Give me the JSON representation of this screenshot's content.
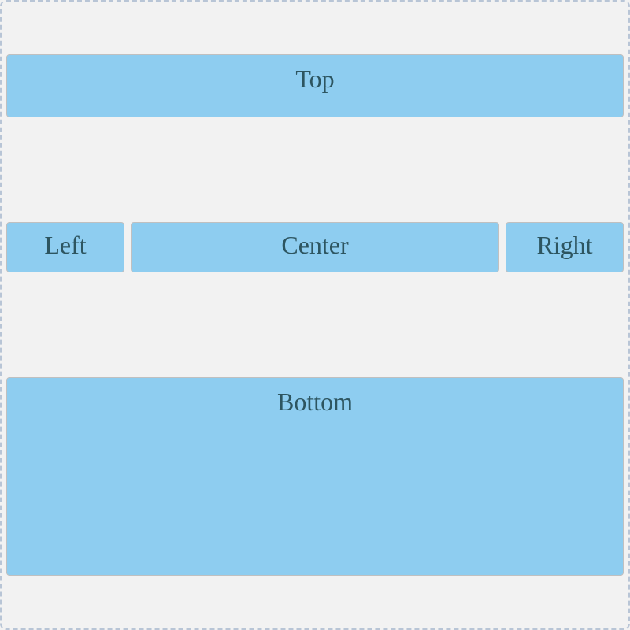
{
  "layout": {
    "top": "Top",
    "left": "Left",
    "center": "Center",
    "right": "Right",
    "bottom": "Bottom"
  },
  "colors": {
    "box_fill": "#8ecdf0",
    "text": "#2d5560",
    "border_dashed": "#b8c5d6",
    "background": "#f2f2f2"
  }
}
